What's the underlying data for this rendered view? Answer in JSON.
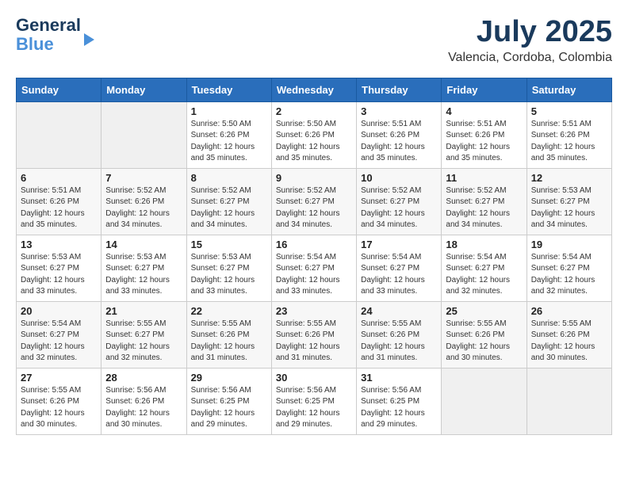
{
  "logo": {
    "line1": "General",
    "line2": "Blue"
  },
  "title": "July 2025",
  "location": "Valencia, Cordoba, Colombia",
  "days_of_week": [
    "Sunday",
    "Monday",
    "Tuesday",
    "Wednesday",
    "Thursday",
    "Friday",
    "Saturday"
  ],
  "weeks": [
    [
      {
        "day": "",
        "info": ""
      },
      {
        "day": "",
        "info": ""
      },
      {
        "day": "1",
        "info": "Sunrise: 5:50 AM\nSunset: 6:26 PM\nDaylight: 12 hours\nand 35 minutes."
      },
      {
        "day": "2",
        "info": "Sunrise: 5:50 AM\nSunset: 6:26 PM\nDaylight: 12 hours\nand 35 minutes."
      },
      {
        "day": "3",
        "info": "Sunrise: 5:51 AM\nSunset: 6:26 PM\nDaylight: 12 hours\nand 35 minutes."
      },
      {
        "day": "4",
        "info": "Sunrise: 5:51 AM\nSunset: 6:26 PM\nDaylight: 12 hours\nand 35 minutes."
      },
      {
        "day": "5",
        "info": "Sunrise: 5:51 AM\nSunset: 6:26 PM\nDaylight: 12 hours\nand 35 minutes."
      }
    ],
    [
      {
        "day": "6",
        "info": "Sunrise: 5:51 AM\nSunset: 6:26 PM\nDaylight: 12 hours\nand 35 minutes."
      },
      {
        "day": "7",
        "info": "Sunrise: 5:52 AM\nSunset: 6:26 PM\nDaylight: 12 hours\nand 34 minutes."
      },
      {
        "day": "8",
        "info": "Sunrise: 5:52 AM\nSunset: 6:27 PM\nDaylight: 12 hours\nand 34 minutes."
      },
      {
        "day": "9",
        "info": "Sunrise: 5:52 AM\nSunset: 6:27 PM\nDaylight: 12 hours\nand 34 minutes."
      },
      {
        "day": "10",
        "info": "Sunrise: 5:52 AM\nSunset: 6:27 PM\nDaylight: 12 hours\nand 34 minutes."
      },
      {
        "day": "11",
        "info": "Sunrise: 5:52 AM\nSunset: 6:27 PM\nDaylight: 12 hours\nand 34 minutes."
      },
      {
        "day": "12",
        "info": "Sunrise: 5:53 AM\nSunset: 6:27 PM\nDaylight: 12 hours\nand 34 minutes."
      }
    ],
    [
      {
        "day": "13",
        "info": "Sunrise: 5:53 AM\nSunset: 6:27 PM\nDaylight: 12 hours\nand 33 minutes."
      },
      {
        "day": "14",
        "info": "Sunrise: 5:53 AM\nSunset: 6:27 PM\nDaylight: 12 hours\nand 33 minutes."
      },
      {
        "day": "15",
        "info": "Sunrise: 5:53 AM\nSunset: 6:27 PM\nDaylight: 12 hours\nand 33 minutes."
      },
      {
        "day": "16",
        "info": "Sunrise: 5:54 AM\nSunset: 6:27 PM\nDaylight: 12 hours\nand 33 minutes."
      },
      {
        "day": "17",
        "info": "Sunrise: 5:54 AM\nSunset: 6:27 PM\nDaylight: 12 hours\nand 33 minutes."
      },
      {
        "day": "18",
        "info": "Sunrise: 5:54 AM\nSunset: 6:27 PM\nDaylight: 12 hours\nand 32 minutes."
      },
      {
        "day": "19",
        "info": "Sunrise: 5:54 AM\nSunset: 6:27 PM\nDaylight: 12 hours\nand 32 minutes."
      }
    ],
    [
      {
        "day": "20",
        "info": "Sunrise: 5:54 AM\nSunset: 6:27 PM\nDaylight: 12 hours\nand 32 minutes."
      },
      {
        "day": "21",
        "info": "Sunrise: 5:55 AM\nSunset: 6:27 PM\nDaylight: 12 hours\nand 32 minutes."
      },
      {
        "day": "22",
        "info": "Sunrise: 5:55 AM\nSunset: 6:26 PM\nDaylight: 12 hours\nand 31 minutes."
      },
      {
        "day": "23",
        "info": "Sunrise: 5:55 AM\nSunset: 6:26 PM\nDaylight: 12 hours\nand 31 minutes."
      },
      {
        "day": "24",
        "info": "Sunrise: 5:55 AM\nSunset: 6:26 PM\nDaylight: 12 hours\nand 31 minutes."
      },
      {
        "day": "25",
        "info": "Sunrise: 5:55 AM\nSunset: 6:26 PM\nDaylight: 12 hours\nand 30 minutes."
      },
      {
        "day": "26",
        "info": "Sunrise: 5:55 AM\nSunset: 6:26 PM\nDaylight: 12 hours\nand 30 minutes."
      }
    ],
    [
      {
        "day": "27",
        "info": "Sunrise: 5:55 AM\nSunset: 6:26 PM\nDaylight: 12 hours\nand 30 minutes."
      },
      {
        "day": "28",
        "info": "Sunrise: 5:56 AM\nSunset: 6:26 PM\nDaylight: 12 hours\nand 30 minutes."
      },
      {
        "day": "29",
        "info": "Sunrise: 5:56 AM\nSunset: 6:25 PM\nDaylight: 12 hours\nand 29 minutes."
      },
      {
        "day": "30",
        "info": "Sunrise: 5:56 AM\nSunset: 6:25 PM\nDaylight: 12 hours\nand 29 minutes."
      },
      {
        "day": "31",
        "info": "Sunrise: 5:56 AM\nSunset: 6:25 PM\nDaylight: 12 hours\nand 29 minutes."
      },
      {
        "day": "",
        "info": ""
      },
      {
        "day": "",
        "info": ""
      }
    ]
  ]
}
